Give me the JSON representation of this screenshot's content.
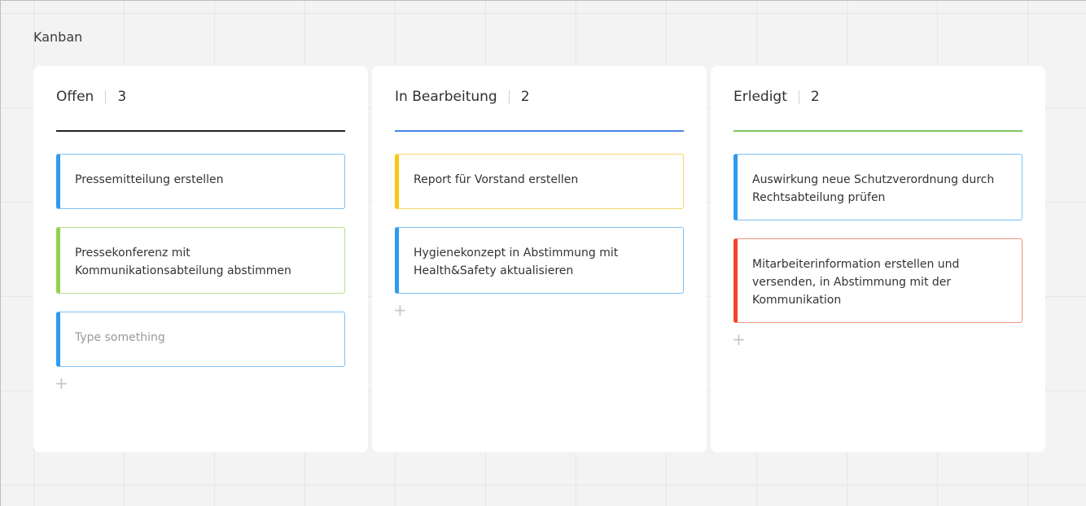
{
  "board": {
    "title": "Kanban"
  },
  "columns": [
    {
      "title": "Offen",
      "count": "3",
      "accent": "#222222",
      "cards": [
        {
          "text": "Pressemitteilung erstellen",
          "color": "#2d9bf0",
          "border": "#7cc1f5"
        },
        {
          "text": "Pressekonferenz mit Kommunikationsabteilung abstimmen",
          "color": "#8fd14f",
          "border": "#b6e08c"
        },
        {
          "text": "Type something",
          "color": "#2d9bf0",
          "border": "#7cc1f5",
          "placeholder": true
        }
      ],
      "add_label": "+"
    },
    {
      "title": "In Bearbeitung",
      "count": "2",
      "accent": "#4a86e8",
      "cards": [
        {
          "text": "Report für Vorstand erstellen",
          "color": "#fac710",
          "border": "#f5d96a"
        },
        {
          "text": "Hygienekonzept in Abstimmung mit Health&Safety aktualisieren",
          "color": "#2d9bf0",
          "border": "#7cc1f5"
        }
      ],
      "add_label": "+"
    },
    {
      "title": "Erledigt",
      "count": "2",
      "accent": "#7dc95e",
      "cards": [
        {
          "text": "Auswirkung neue Schutzverordnung durch Rechtsabteilung prüfen",
          "color": "#2d9bf0",
          "border": "#7cc1f5"
        },
        {
          "text": "Mitarbeiterinformation erstellen und versenden, in Abstimmung mit der Kommunikation",
          "color": "#f24726",
          "border": "#f08f7f"
        }
      ],
      "add_label": "+"
    }
  ]
}
